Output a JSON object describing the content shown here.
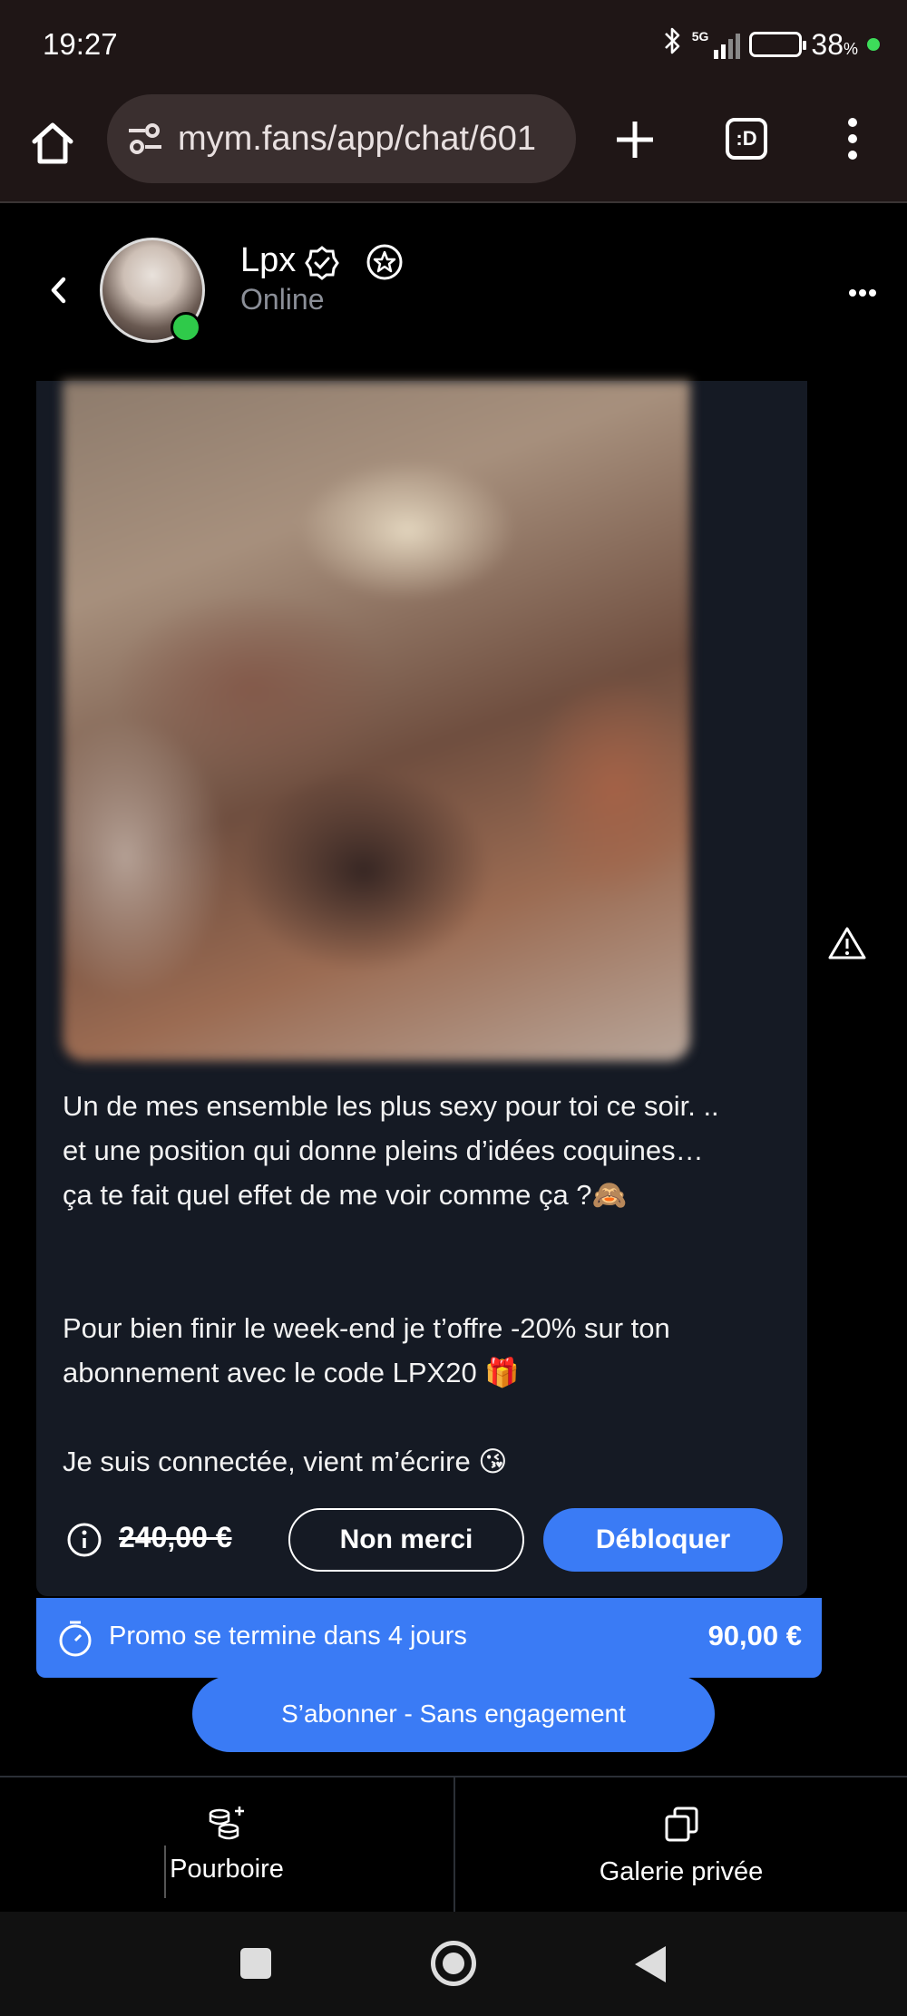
{
  "status_bar": {
    "time": "19:27",
    "network_label": "5G",
    "battery_percent": "38",
    "battery_percent_sign": "%",
    "battery_level": 0.38,
    "bluetooth_icon": "bluetooth-icon"
  },
  "browser": {
    "url": "mym.fans/app/chat/601",
    "tabs_label": ":D"
  },
  "chat": {
    "contact_name": "Lpx",
    "contact_status": "Online"
  },
  "message": {
    "text": "Un de mes ensemble les plus sexy pour toi ce soir. ..\net une position qui donne pleins d’idées coquines…\nça te fait quel effet de me voir comme ça ?🙈\n\n\nPour bien finir le week-end je t’offre -20% sur ton\nabonnement avec le code LPX20 🎁\n\nJe suis connectée, vient m’écrire 😘",
    "old_price": "240,00 €",
    "decline_label": "Non merci",
    "unlock_label": "Débloquer"
  },
  "promo": {
    "text": "Promo se termine dans 4 jours",
    "price": "90,00 €"
  },
  "subscribe_label": "S’abonner - Sans engagement",
  "actions": {
    "tip_label": "Pourboire",
    "gallery_label": "Galerie privée"
  },
  "colors": {
    "accent": "#3a7bf5",
    "online": "#2fca4a",
    "card_bg": "#151a24",
    "browser_bg": "#1f1616"
  }
}
